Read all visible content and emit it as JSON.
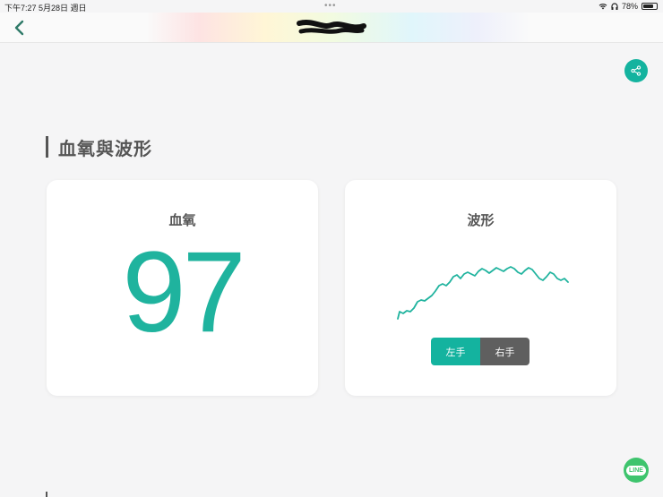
{
  "status_bar": {
    "time_date": "下午7:27  5月28日 週日",
    "battery": "78%",
    "battery_level": 0.78
  },
  "nav": {
    "title": "",
    "back_icon": "chevron-left-icon"
  },
  "share_icon": "share-icon",
  "section": {
    "title": "血氧與波形"
  },
  "spo2_card": {
    "title": "血氧",
    "value": "97"
  },
  "wave_card": {
    "title": "波形",
    "buttons": {
      "left": "左手",
      "right": "右手"
    },
    "selected": "left"
  },
  "line_button": {
    "label": "LINE"
  },
  "colors": {
    "accent": "#14b39f",
    "value_color": "#1fb39e",
    "inactive_button": "#5f5f5f",
    "line_green": "#3ec46d"
  }
}
